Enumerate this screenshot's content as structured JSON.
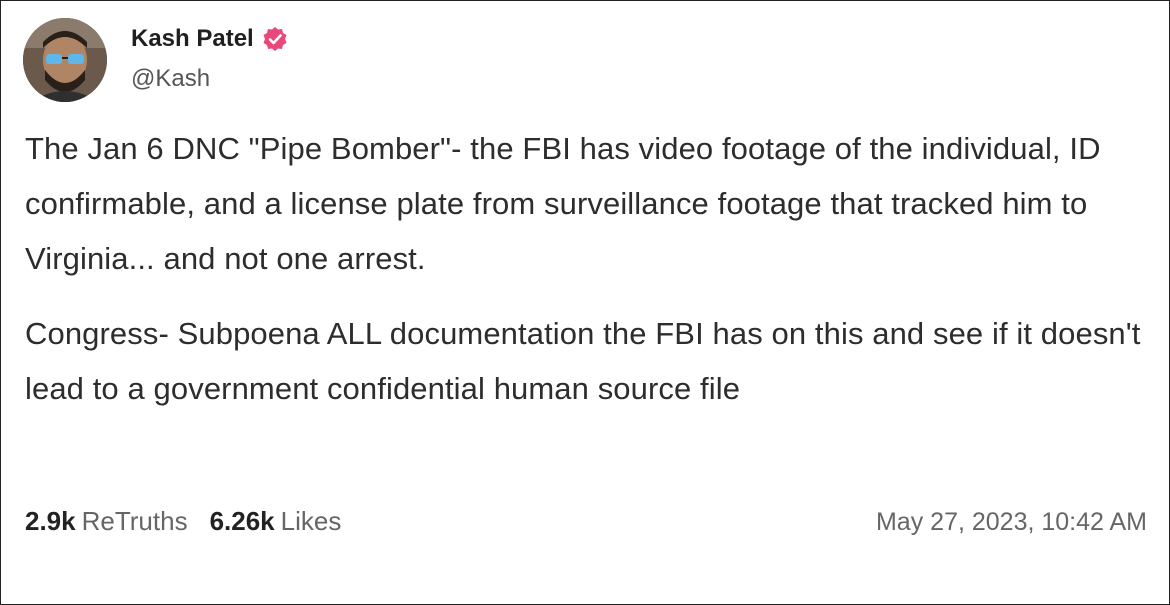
{
  "author": {
    "display_name": "Kash Patel",
    "handle": "@Kash",
    "avatar_icon": "user-avatar",
    "verified_icon": "verified-badge-icon",
    "verified_color": "#e8487a"
  },
  "post": {
    "paragraph_1": "The Jan 6 DNC \"Pipe Bomber\"- the FBI has video footage of the individual, ID confirmable, and a license plate from surveillance footage that tracked him to Virginia... and not one arrest.",
    "paragraph_2": "Congress- Subpoena ALL documentation the FBI has on this and see if it doesn't lead to a government confidential human source file"
  },
  "stats": {
    "retruths_count": "2.9k",
    "retruths_label": "ReTruths",
    "likes_count": "6.26k",
    "likes_label": "Likes"
  },
  "timestamp": "May 27, 2023, 10:42 AM"
}
